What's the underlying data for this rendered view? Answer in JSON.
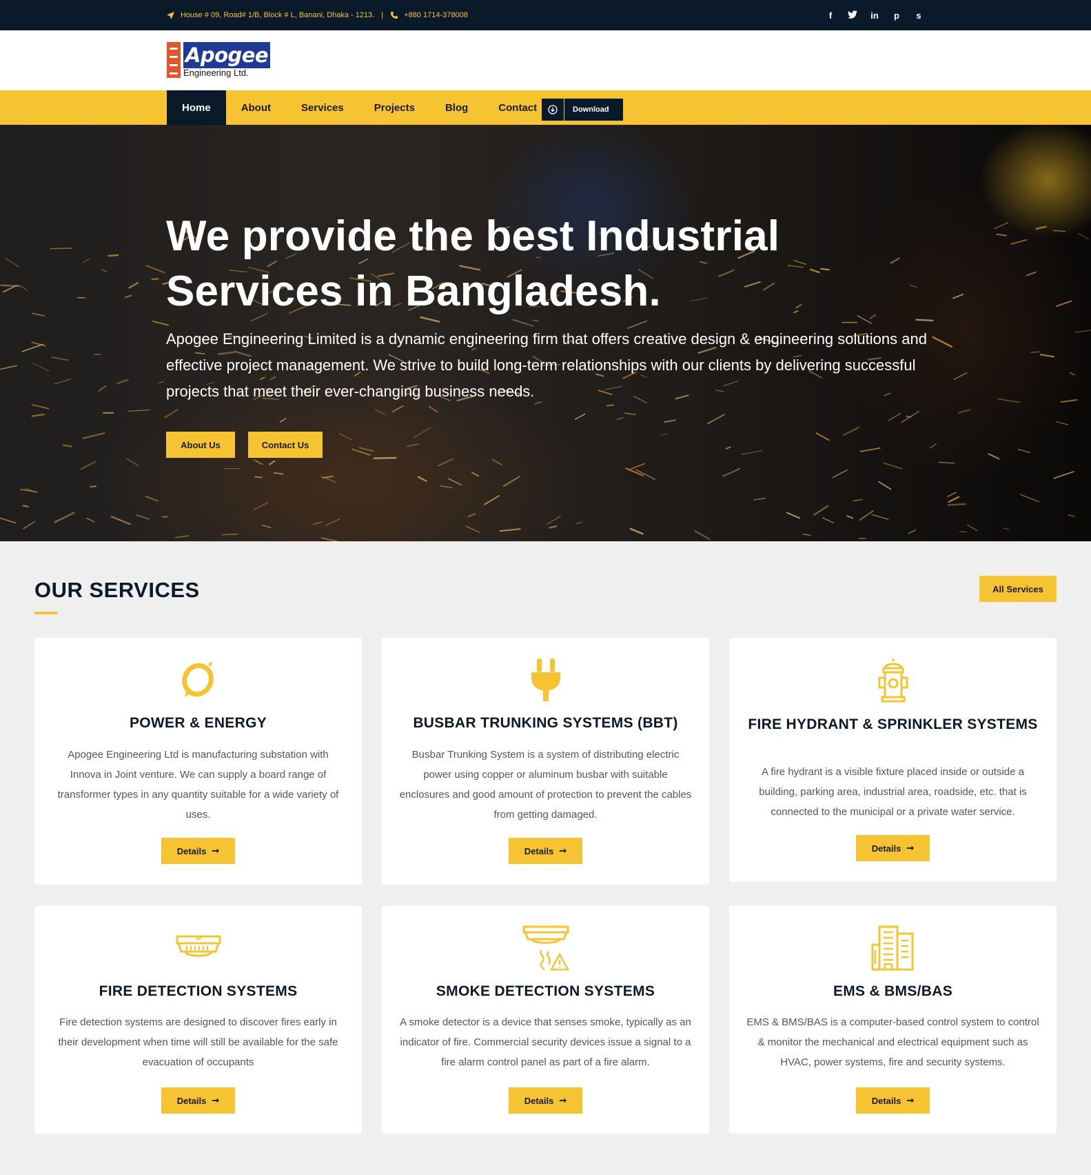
{
  "topbar": {
    "address": "House # 09, Road# 1/B, Block # L, Banani, Dhaka - 1213.",
    "separator": "|",
    "phone": "+880 1714-378008",
    "social": [
      "f",
      "t",
      "in",
      "p",
      "s"
    ]
  },
  "logo": {
    "name": "Apogee",
    "subtitle": "Engineering Ltd."
  },
  "nav": {
    "items": [
      {
        "label": "Home",
        "active": true
      },
      {
        "label": "About"
      },
      {
        "label": "Services"
      },
      {
        "label": "Projects"
      },
      {
        "label": "Blog"
      },
      {
        "label": "Contact"
      }
    ],
    "download_label": "Download"
  },
  "hero": {
    "title": "We provide the best Industrial Services in Bangladesh.",
    "description": "Apogee Engineering Limited is a dynamic engineering firm that offers creative design & engineering solutions and effective project management. We strive to build long-term relationships with our clients by delivering successful projects that meet their ever-changing business needs.",
    "about_button": "About Us",
    "contact_button": "Contact Us"
  },
  "services": {
    "title": "OUR SERVICES",
    "all_button": "All Services",
    "details_label": "Details",
    "cards": [
      {
        "title": "POWER & ENERGY",
        "icon": "power-energy-icon",
        "text": "Apogee Engineering Ltd is manufacturing substation with Innova in Joint venture. We can supply a board range of transformer types in any quantity suitable for a wide variety of uses."
      },
      {
        "title": "BUSBAR TRUNKING SYSTEMS (BBT)",
        "icon": "plug-icon",
        "text": "Busbar Trunking System is a system of distributing electric power using copper or aluminum busbar with suitable enclosures and good amount of protection to prevent the cables from getting damaged."
      },
      {
        "title": "FIRE HYDRANT & SPRINKLER SYSTEMS",
        "icon": "fire-hydrant-icon",
        "text": "A fire hydrant is a visible fixture placed inside or outside a building, parking area, industrial area, roadside, etc. that is connected to the municipal or a private water service."
      },
      {
        "title": "FIRE DETECTION SYSTEMS",
        "icon": "fire-detector-icon",
        "text": "Fire detection systems are designed to discover fires early in their development when time will still be available for the safe evacuation of occupants"
      },
      {
        "title": "SMOKE DETECTION SYSTEMS",
        "icon": "smoke-detector-icon",
        "text": "A smoke detector is a device that senses smoke, typically as an indicator of fire. Commercial security devices issue a signal to a fire alarm control panel as part of a fire alarm."
      },
      {
        "title": "EMS & BMS/BAS",
        "icon": "building-icon",
        "text": "EMS & BMS/BAS is a computer-based control system to control & monitor the mechanical and electrical equipment such as HVAC, power systems, fire and security systems."
      }
    ]
  },
  "colors": {
    "accent": "#f6c332",
    "dark": "#0b1a2b",
    "logo_blue": "#1f3a93",
    "logo_orange": "#e2572a"
  }
}
